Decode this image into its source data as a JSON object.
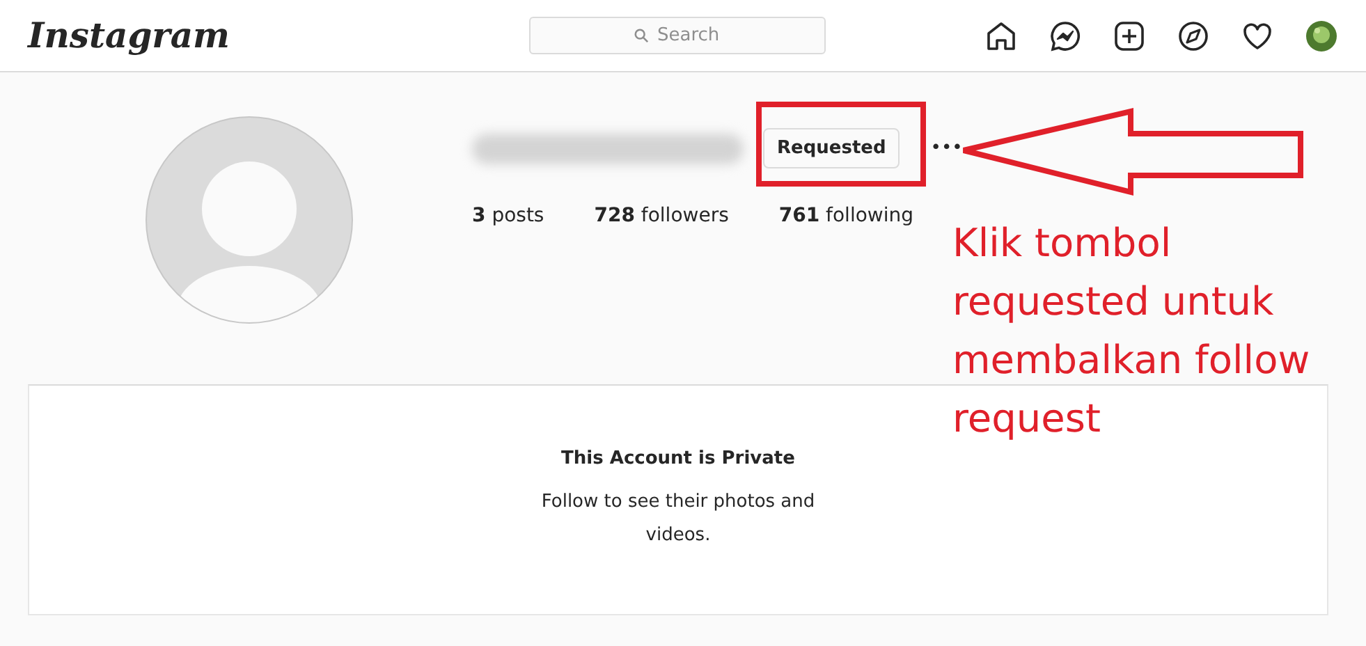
{
  "header": {
    "logo": "Instagram",
    "search": {
      "placeholder": "Search"
    }
  },
  "profile": {
    "button": "Requested",
    "more": "•••",
    "stats": [
      "**3** posts",
      "**728** followers",
      "**761** following"
    ]
  },
  "private_notice": {
    "title": "This Account is Private",
    "message": "Follow to see their photos and videos."
  },
  "annotation": {
    "text": "Klik tombol requested untuk membalkan follow request"
  }
}
